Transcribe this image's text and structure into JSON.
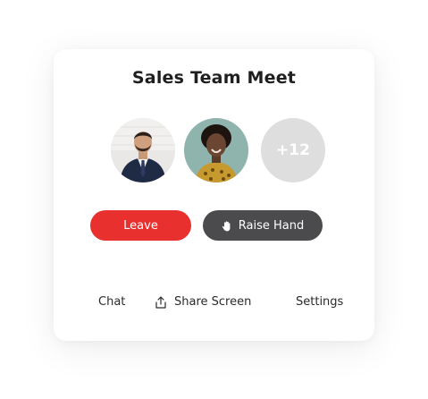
{
  "meeting": {
    "title": "Sales Team Meet"
  },
  "participants": {
    "avatars": [
      {
        "name": "participant-1"
      },
      {
        "name": "participant-2"
      }
    ],
    "more_count_label": "+12"
  },
  "actions": {
    "leave_label": "Leave",
    "raise_hand_label": "Raise Hand"
  },
  "footer": {
    "chat_label": "Chat",
    "share_label": "Share Screen",
    "settings_label": "Settings"
  },
  "colors": {
    "leave": "#e8302f",
    "raise_hand": "#4b4b4e",
    "more_avatar_bg": "#dedede"
  },
  "icons": {
    "raise_hand": "hand-icon",
    "share_screen": "share-icon"
  }
}
